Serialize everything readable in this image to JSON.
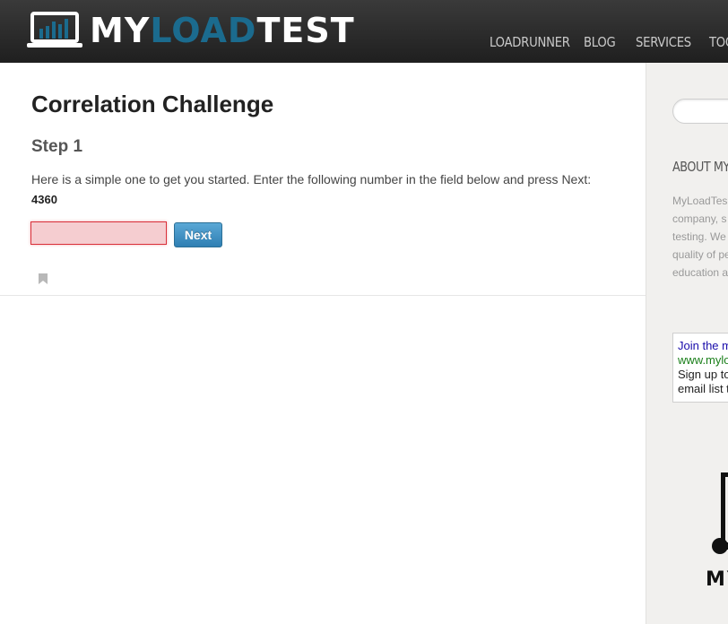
{
  "header": {
    "logo": {
      "part1": "MY",
      "part2": "LOAD",
      "part3": "TEST"
    },
    "nav": [
      "LOADRUNNER",
      "BLOG",
      "SERVICES",
      "TOO"
    ]
  },
  "main": {
    "title": "Correlation Challenge",
    "step": "Step 1",
    "instructions": "Here is a simple one to get you started. Enter the following number in the field below and press Next:",
    "number": "4360",
    "input_value": "",
    "next_label": "Next"
  },
  "sidebar": {
    "search_placeholder": "",
    "about_heading": "ABOUT MY",
    "about_lines": [
      "MyLoadTes",
      "company, s",
      "testing. We",
      "quality of pe",
      "education a"
    ],
    "ad": {
      "title": "Join the m",
      "url": "www.mylo",
      "desc1": "Sign up to",
      "desc2": "email list t"
    },
    "logo_text": "MY"
  },
  "colors": {
    "header_bg": "#2a2a2a",
    "logo_accent": "#1b6b8e",
    "input_error_bg": "#f5cdd0",
    "input_error_border": "#d9303a",
    "button_blue": "#3b8ec2",
    "sidebar_bg": "#f1f0ee"
  },
  "icons": [
    "laptop-chart-logo-icon",
    "bookmark-icon",
    "sidebar-logo-icon"
  ]
}
